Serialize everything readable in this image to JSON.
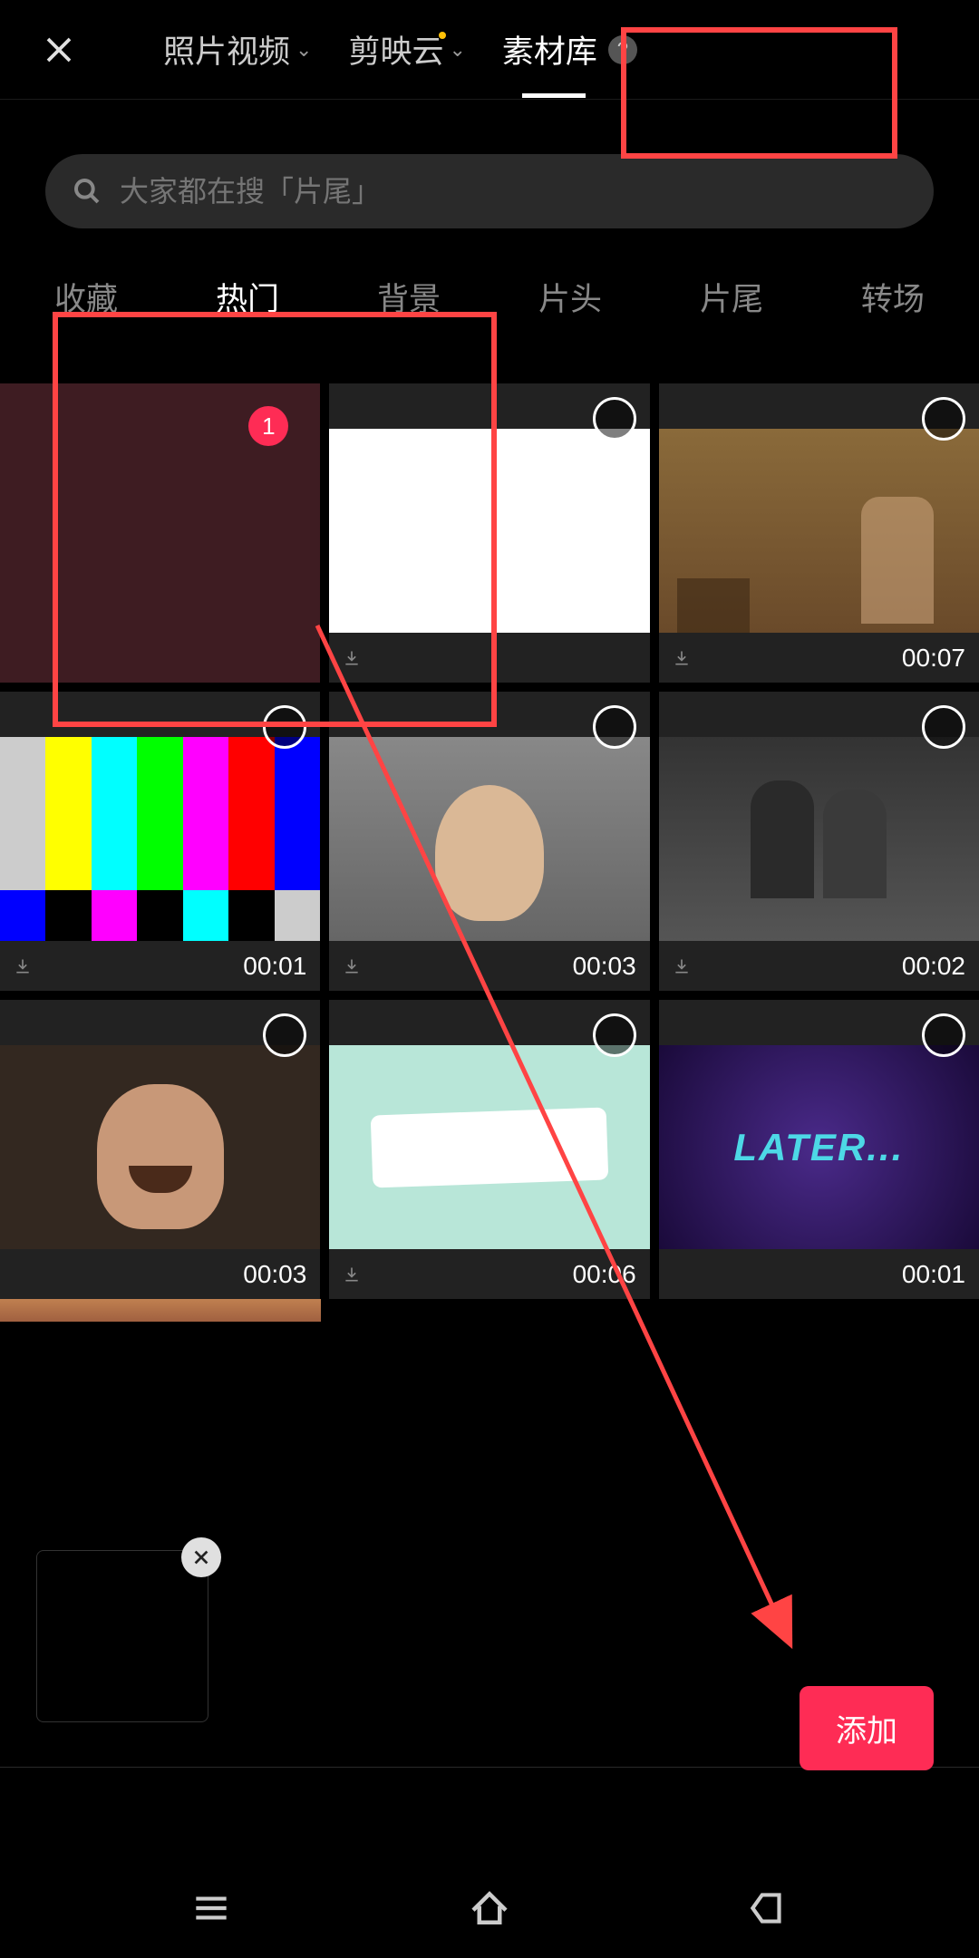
{
  "header": {
    "tabs": [
      {
        "label": "照片视频",
        "hasDropdown": true
      },
      {
        "label": "剪映云",
        "hasDropdown": true,
        "hasDot": true
      },
      {
        "label": "素材库",
        "active": true,
        "hasHelp": true
      }
    ]
  },
  "search": {
    "placeholder": "大家都在搜「片尾」"
  },
  "categories": [
    {
      "label": "收藏"
    },
    {
      "label": "热门",
      "active": true
    },
    {
      "label": "背景"
    },
    {
      "label": "片头"
    },
    {
      "label": "片尾"
    },
    {
      "label": "转场"
    }
  ],
  "items": [
    {
      "selected": true,
      "badge": "1",
      "type": "dark-red"
    },
    {
      "duration": "",
      "type": "white"
    },
    {
      "duration": "00:07",
      "type": "sepia"
    },
    {
      "duration": "00:01",
      "type": "colorbars"
    },
    {
      "duration": "00:03",
      "type": "face"
    },
    {
      "duration": "00:02",
      "type": "movie"
    },
    {
      "duration": "00:03",
      "type": "laugh"
    },
    {
      "duration": "00:06",
      "type": "note"
    },
    {
      "duration": "00:01",
      "type": "later",
      "text": "LATER..."
    }
  ],
  "addButton": {
    "label": "添加"
  }
}
